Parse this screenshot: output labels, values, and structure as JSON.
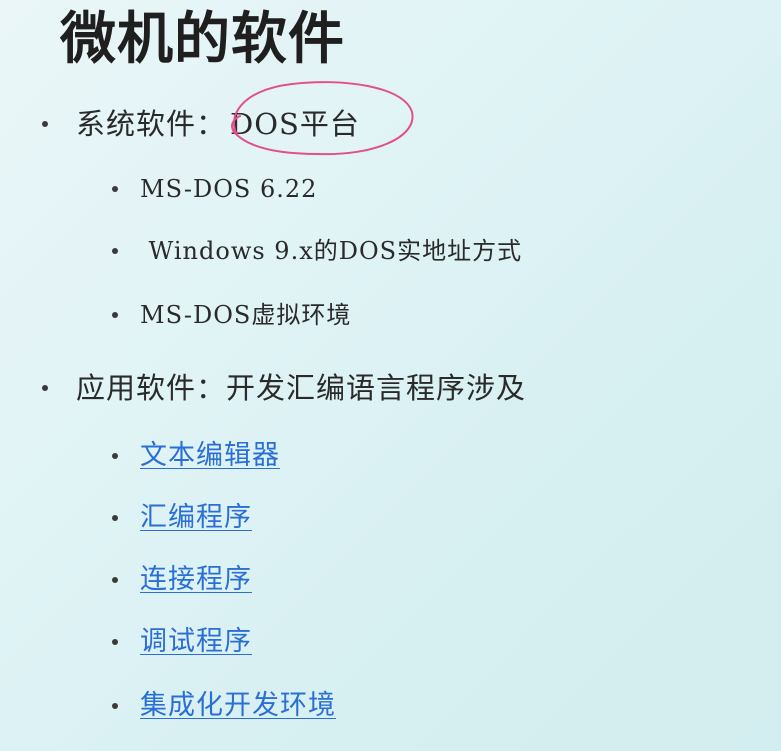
{
  "slide": {
    "title": "微机的软件",
    "sections": [
      {
        "label": "系统软件：",
        "highlight": "DOS平台",
        "items": [
          "MS-DOS 6.22",
          " Windows 9.x的DOS实地址方式",
          "MS-DOS虚拟环境"
        ]
      },
      {
        "label": "应用软件：开发汇编语言程序涉及",
        "links": [
          "文本编辑器",
          "汇编程序",
          "连接程序",
          "调试程序",
          "集成化开发环境"
        ]
      }
    ]
  },
  "colors": {
    "background": "#dff3f5",
    "text": "#262626",
    "link": "#2b6fd6",
    "annotation": "#e0508a"
  }
}
